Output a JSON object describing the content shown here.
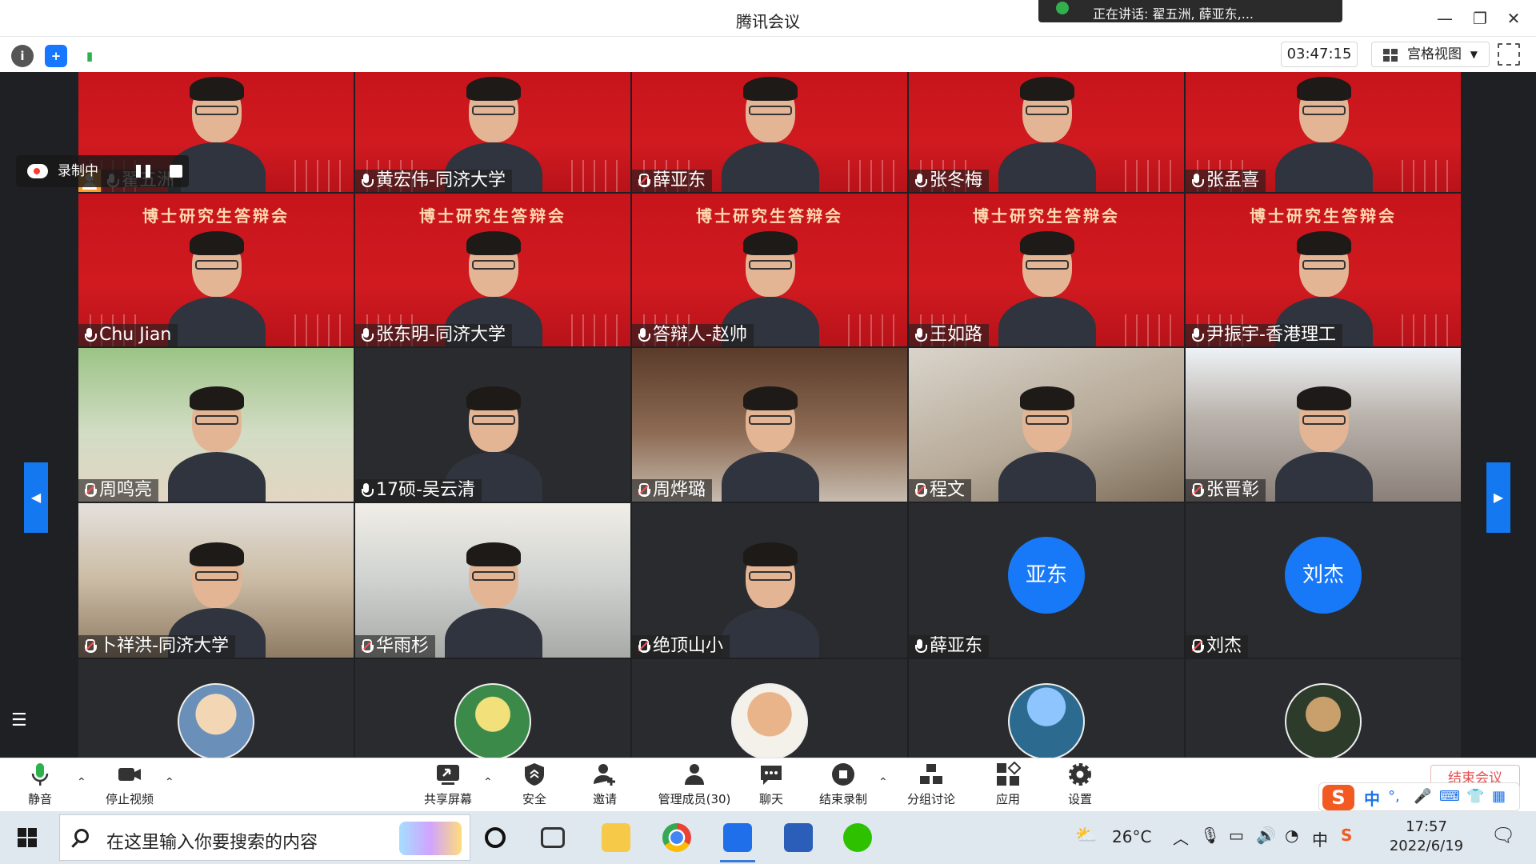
{
  "window": {
    "title": "腾讯会议",
    "speaking_label": "正在讲话: 翟五洲, 薛亚东,..."
  },
  "infobar": {
    "timer": "03:47:15",
    "view_mode": "宫格视图"
  },
  "recording": {
    "label": "录制中"
  },
  "participants": [
    {
      "name": "翟五洲",
      "muted": false,
      "host": true,
      "bg": "red"
    },
    {
      "name": "黄宏伟-同济大学",
      "muted": false,
      "bg": "red"
    },
    {
      "name": "薛亚东",
      "muted": true,
      "bg": "red"
    },
    {
      "name": "张冬梅",
      "muted": false,
      "bg": "red"
    },
    {
      "name": "张孟喜",
      "muted": false,
      "bg": "red"
    },
    {
      "name": "Chu Jian",
      "muted": false,
      "bg": "red"
    },
    {
      "name": "张东明-同济大学",
      "muted": false,
      "bg": "red"
    },
    {
      "name": "答辩人-赵帅",
      "muted": false,
      "bg": "red"
    },
    {
      "name": "王如路",
      "muted": false,
      "bg": "red"
    },
    {
      "name": "尹振宇-香港理工",
      "muted": false,
      "bg": "red"
    },
    {
      "name": "周鸣亮",
      "muted": true,
      "bg": "outdoor"
    },
    {
      "name": "17硕-吴云清",
      "muted": false,
      "bg": "dark"
    },
    {
      "name": "周烨璐",
      "muted": true,
      "bg": "books"
    },
    {
      "name": "程文",
      "muted": true,
      "bg": "room"
    },
    {
      "name": "张晋彰",
      "muted": true,
      "bg": "building"
    },
    {
      "name": "卜祥洪-同济大学",
      "muted": true,
      "bg": "shelf"
    },
    {
      "name": "华雨杉",
      "muted": true,
      "bg": "bright"
    },
    {
      "name": "绝顶山小",
      "muted": true,
      "bg": "dark"
    },
    {
      "name": "薛亚东",
      "muted": false,
      "bg": "dark",
      "avatar_text": "亚东"
    },
    {
      "name": "刘杰",
      "muted": true,
      "bg": "dark",
      "avatar_text": "刘杰"
    }
  ],
  "banner_text": "博士研究生答辩会",
  "toolbar": {
    "mute": "静音",
    "stop_video": "停止视频",
    "share_screen": "共享屏幕",
    "security": "安全",
    "invite": "邀请",
    "manage_members": "管理成员(30)",
    "chat": "聊天",
    "end_recording": "结束录制",
    "breakout": "分组讨论",
    "apps": "应用",
    "settings": "设置",
    "end_meeting": "结束会议"
  },
  "ime": {
    "logo": "S",
    "lang": "中"
  },
  "taskbar": {
    "search_placeholder": "在这里输入你要搜索的内容",
    "weather": "26°C",
    "time": "17:57",
    "date": "2022/6/19",
    "tray_lang": "中"
  },
  "colors": {
    "accent": "#1478f0",
    "tile_red": "#c7141b",
    "stage_bg": "#1f2023"
  }
}
